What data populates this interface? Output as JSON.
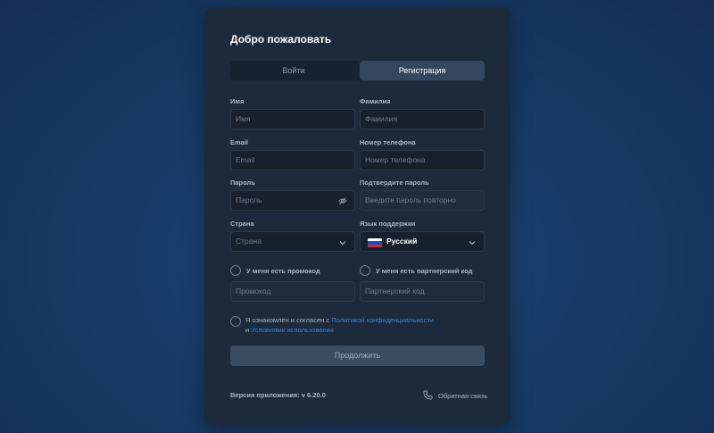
{
  "header": {
    "title": "Добро пожаловать"
  },
  "tabs": {
    "login": "Войти",
    "register": "Регистрация"
  },
  "fields": {
    "first_name": {
      "label": "Имя",
      "placeholder": "Имя"
    },
    "last_name": {
      "label": "Фамилия",
      "placeholder": "Фамилия"
    },
    "email": {
      "label": "Email",
      "placeholder": "Email"
    },
    "phone": {
      "label": "Номер телефона",
      "placeholder": "Номер телефона"
    },
    "password": {
      "label": "Пароль",
      "placeholder": "Пароль"
    },
    "confirm_password": {
      "label": "Подтвердите пароль",
      "placeholder": "Введите пароль повторно"
    },
    "country": {
      "label": "Страна",
      "placeholder": "Страна"
    },
    "support_language": {
      "label": "Язык поддержки",
      "value": "Русский"
    },
    "promo": {
      "label": "У меня есть промокод",
      "placeholder": "Промокод"
    },
    "partner": {
      "label": "У меня есть партнерский код",
      "placeholder": "Партнерский код"
    }
  },
  "agreement": {
    "prefix": "Я ознакомлен и согласен с ",
    "privacy_link": "Политикой конфиденциальности",
    "middle": "и ",
    "terms_link": "Условиями использования"
  },
  "actions": {
    "continue": "Продолжить"
  },
  "footer": {
    "version": "Версия приложения: v 6.20.0",
    "feedback": "Обратная связь"
  },
  "colors": {
    "card": "#1c2a3b",
    "accent_link": "#3b82d8",
    "active_tab": "#34475e"
  },
  "icons": {
    "password_toggle": "eye-off-icon",
    "dropdown": "chevron-down-icon",
    "feedback": "phone-icon",
    "language": "russia-flag-icon"
  }
}
